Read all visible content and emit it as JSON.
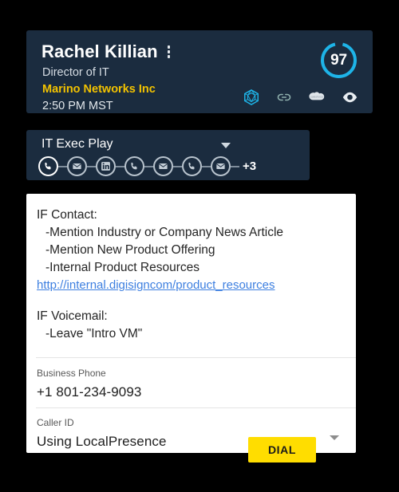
{
  "contact": {
    "name": "Rachel Killian",
    "title": "Director of IT",
    "company": "Marino Networks Inc",
    "local_time": "2:50 PM MST",
    "menu_icon": "kebab-menu-icon",
    "score": "97",
    "score_ring_color": "#1eb4e8",
    "company_color": "#f2c200",
    "header_bg": "#1b2c3f",
    "integrations": [
      {
        "icon": "polygon-gem-icon",
        "label": "Outreach"
      },
      {
        "icon": "link-icon",
        "label": "Linked Record"
      },
      {
        "icon": "salesforce-cloud-icon",
        "label": "Salesforce"
      },
      {
        "icon": "eye-icon",
        "label": "View Activity"
      }
    ]
  },
  "play": {
    "name": "IT Exec Play",
    "caret_icon": "chevron-down-icon",
    "more_count": "+3",
    "steps": [
      {
        "icon": "phone-icon",
        "active": true
      },
      {
        "icon": "email-icon",
        "active": false
      },
      {
        "icon": "linkedin-icon",
        "active": false
      },
      {
        "icon": "phone-icon",
        "active": false
      },
      {
        "icon": "email-icon",
        "active": false
      },
      {
        "icon": "phone-icon",
        "active": false
      },
      {
        "icon": "email-icon",
        "active": false
      }
    ]
  },
  "script": {
    "contact_heading": "IF Contact:",
    "contact_bullets": [
      "-Mention Industry or Company News Article",
      "-Mention New Product Offering",
      "-Internal Product Resources"
    ],
    "link_text": "http://internal.digisigncom/product_resources",
    "voicemail_heading": "IF Voicemail:",
    "voicemail_bullets": [
      "-Leave \"Intro VM\""
    ]
  },
  "fields": {
    "business_phone": {
      "label": "Business Phone",
      "value": "+1 801-234-9093"
    },
    "caller_id": {
      "label": "Caller ID",
      "value": "Using LocalPresence",
      "caret_icon": "chevron-down-icon"
    }
  },
  "actions": {
    "dial_label": "DIAL",
    "dial_color": "#ffdd00"
  }
}
